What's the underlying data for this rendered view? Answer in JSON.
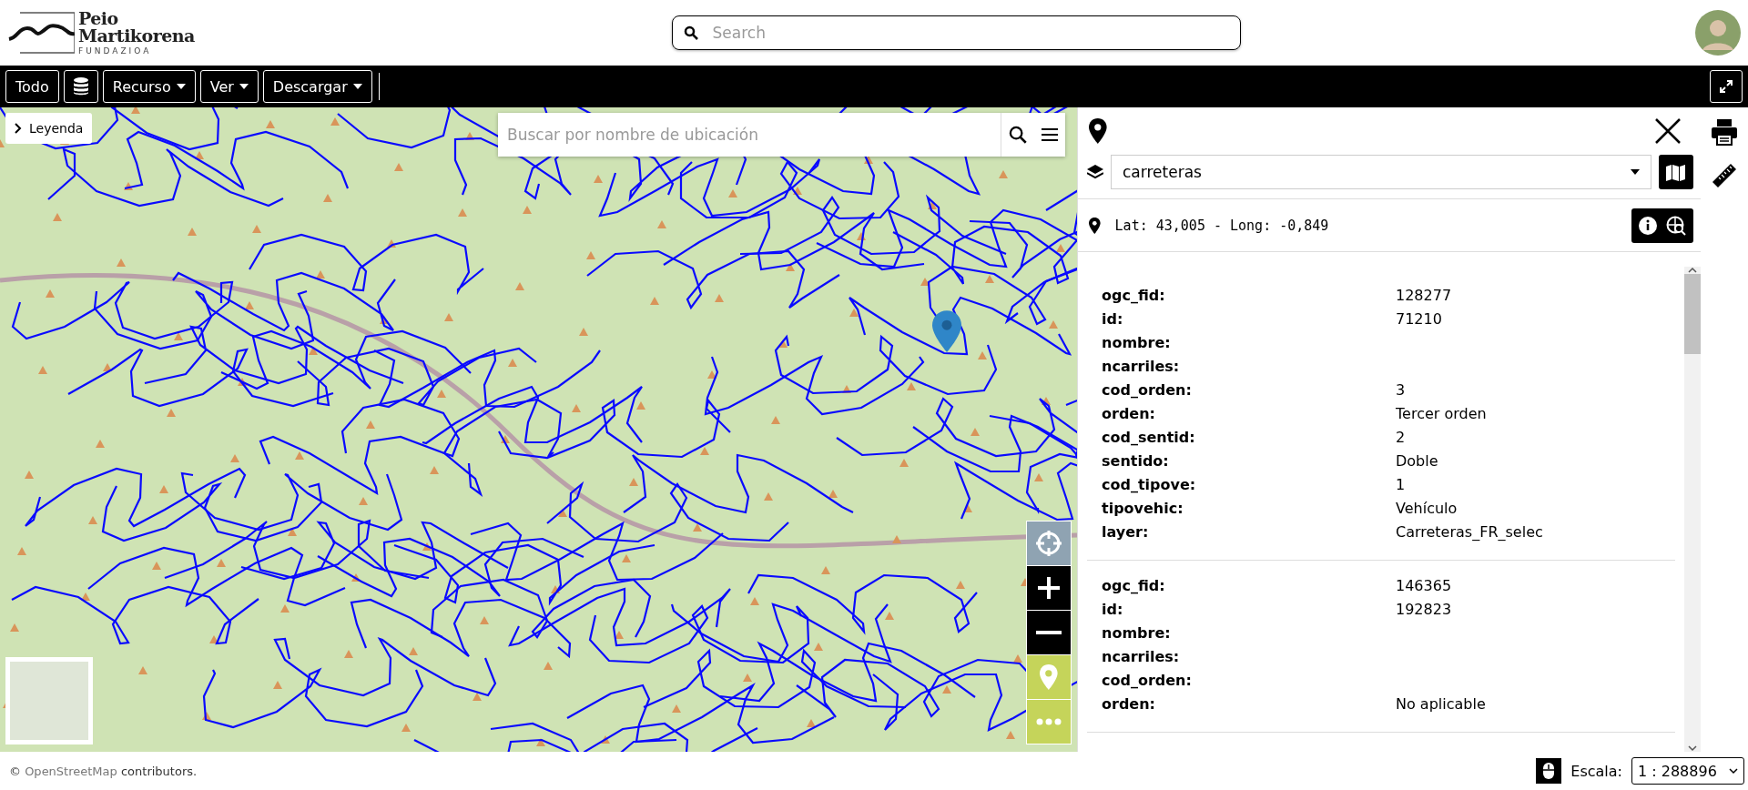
{
  "header": {
    "logo": {
      "line1": "Peio",
      "line2": "Martikorena",
      "subtitle": "FUNDAZIOA"
    },
    "search": {
      "placeholder": "Search"
    }
  },
  "toolbar": [
    {
      "kind": "button",
      "label": "Todo"
    },
    {
      "kind": "icon"
    },
    {
      "kind": "dropdown",
      "label": "Recurso"
    },
    {
      "kind": "dropdown",
      "label": "Ver"
    },
    {
      "kind": "dropdown",
      "label": "Descargar"
    }
  ],
  "map": {
    "legend": {
      "label": "Leyenda"
    },
    "location_search": {
      "placeholder": "Buscar por nombre de ubicación"
    },
    "attribution": {
      "prefix": "©",
      "link": "OpenStreetMap",
      "suffix": "contributors."
    }
  },
  "panel": {
    "layer_select": {
      "value": "carreteras"
    },
    "coordinates": "Lat: 43,005 - Long: -0,849",
    "records": [
      {
        "fields": [
          {
            "name": "ogc_fid:",
            "value": "128277"
          },
          {
            "name": "id:",
            "value": "71210"
          },
          {
            "name": "nombre:"
          },
          {
            "name": "ncarriles:"
          },
          {
            "name": "cod_orden:",
            "value": "3"
          },
          {
            "name": "orden:",
            "value": "Tercer orden"
          },
          {
            "name": "cod_sentid:",
            "value": "2"
          },
          {
            "name": "sentido:",
            "value": "Doble"
          },
          {
            "name": "cod_tipove:",
            "value": "1"
          },
          {
            "name": "tipovehic:",
            "value": "Vehículo"
          },
          {
            "name": "layer:",
            "value": "Carreteras_FR_selec"
          }
        ]
      },
      {
        "fields": [
          {
            "name": "ogc_fid:",
            "value": "146365"
          },
          {
            "name": "id:",
            "value": "192823"
          },
          {
            "name": "nombre:"
          },
          {
            "name": "ncarriles:"
          },
          {
            "name": "cod_orden:"
          },
          {
            "name": "orden:",
            "value": "No aplicable"
          }
        ]
      }
    ]
  },
  "footer": {
    "scale_label": "Escala:",
    "scale_value": "1 : 288896"
  }
}
